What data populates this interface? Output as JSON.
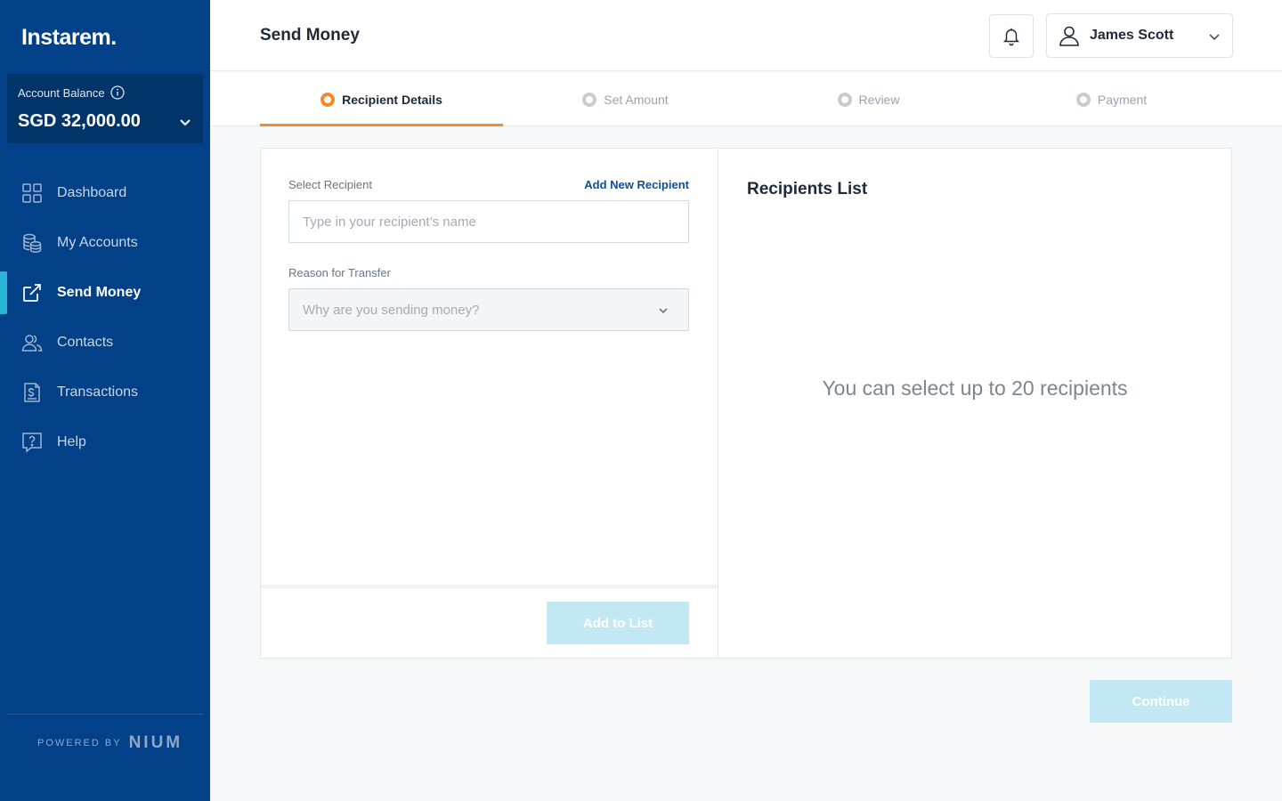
{
  "brand": {
    "logo_text": "Instarem.",
    "powered_by": "POWERED BY",
    "powered_brand": "NIUM"
  },
  "balance": {
    "label": "Account Balance",
    "value": "SGD 32,000.00"
  },
  "sidebar": {
    "items": [
      {
        "label": "Dashboard",
        "icon": "dashboard-grid-icon",
        "active": false
      },
      {
        "label": "My Accounts",
        "icon": "coins-stack-icon",
        "active": false
      },
      {
        "label": "Send Money",
        "icon": "external-send-icon",
        "active": true
      },
      {
        "label": "Contacts",
        "icon": "contacts-people-icon",
        "active": false
      },
      {
        "label": "Transactions",
        "icon": "receipt-icon",
        "active": false
      },
      {
        "label": "Help",
        "icon": "help-question-icon",
        "active": false
      }
    ]
  },
  "header": {
    "title": "Send Money",
    "user_name": "James Scott"
  },
  "stepper": {
    "steps": [
      {
        "label": "Recipient Details",
        "active": true
      },
      {
        "label": "Set Amount",
        "active": false
      },
      {
        "label": "Review",
        "active": false
      },
      {
        "label": "Payment",
        "active": false
      }
    ]
  },
  "form": {
    "recipient_label": "Select Recipient",
    "add_new_link": "Add New Recipient",
    "recipient_placeholder": "Type in your recipient’s name",
    "reason_label": "Reason for Transfer",
    "reason_placeholder": "Why are you sending money?",
    "add_button": "Add to List"
  },
  "recipients": {
    "title": "Recipients List",
    "empty_message": "You can select up to 20 recipients"
  },
  "actions": {
    "continue_button": "Continue"
  },
  "colors": {
    "sidebar_bg": "#024187",
    "accent_orange": "#f5892e",
    "active_bar": "#29b6d6",
    "disabled_button": "#c2e9f3",
    "link_blue": "#0b4f9c"
  }
}
